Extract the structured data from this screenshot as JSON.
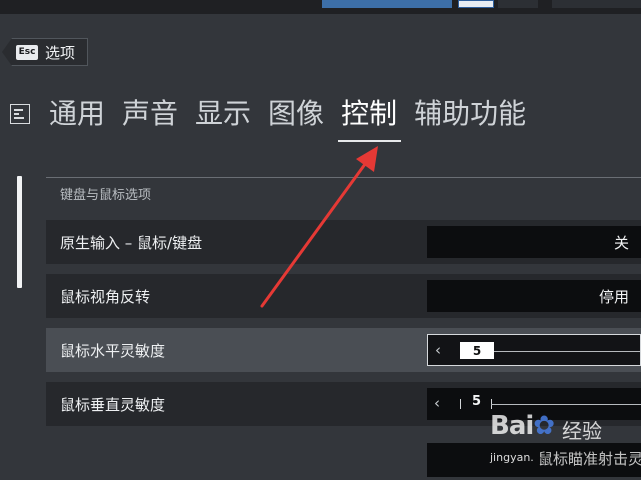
{
  "header": {
    "esc_key": "Esc",
    "back_label": "选项"
  },
  "tabs": [
    {
      "label": "通用",
      "active": false
    },
    {
      "label": "声音",
      "active": false
    },
    {
      "label": "显示",
      "active": false
    },
    {
      "label": "图像",
      "active": false
    },
    {
      "label": "控制",
      "active": true
    },
    {
      "label": "辅助功能",
      "active": false
    }
  ],
  "section": {
    "title": "键盘与鼠标选项"
  },
  "settings": [
    {
      "label": "原生输入 – 鼠标/键盘",
      "value": "关"
    },
    {
      "label": "鼠标视角反转",
      "value": "停用"
    },
    {
      "label": "鼠标水平灵敏度",
      "value": "5"
    },
    {
      "label": "鼠标垂直灵敏度",
      "value": "5"
    }
  ],
  "watermark": {
    "logo_text": "Bai",
    "logo_suffix": "经验",
    "site": "jingyan.",
    "ghost_text": "鼠标瞄准射击灵"
  },
  "colors": {
    "accent_arrow": "#e53935",
    "background": "#33363b"
  }
}
